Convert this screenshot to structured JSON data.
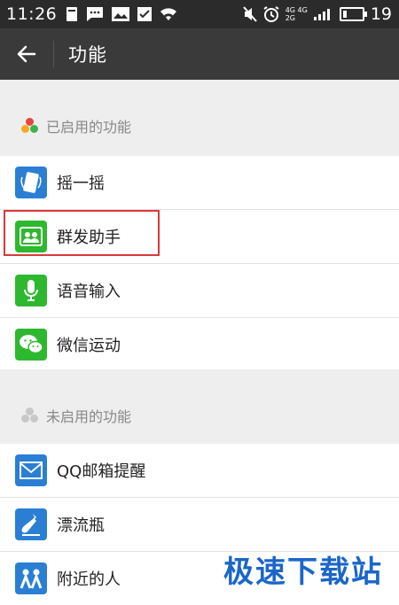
{
  "status_bar": {
    "time": "11:26",
    "network_top": "4G 4G",
    "network_bottom": "2G",
    "battery_level": "19",
    "battery_fraction": 0.19
  },
  "title_bar": {
    "title": "功能"
  },
  "enabled_section": {
    "header": "已启用的功能",
    "items": [
      {
        "label": "摇一摇",
        "icon": "shake-icon",
        "color": "#2a7fd4"
      },
      {
        "label": "群发助手",
        "icon": "mass-send-icon",
        "color": "#2eb82e"
      },
      {
        "label": "语音输入",
        "icon": "microphone-icon",
        "color": "#2eb82e"
      },
      {
        "label": "微信运动",
        "icon": "wechat-sports-icon",
        "color": "#2eb82e"
      }
    ]
  },
  "disabled_section": {
    "header": "未启用的功能",
    "items": [
      {
        "label": "QQ邮箱提醒",
        "icon": "mail-icon",
        "color": "#2a7fd4"
      },
      {
        "label": "漂流瓶",
        "icon": "bottle-icon",
        "color": "#2a7fd4"
      },
      {
        "label": "附近的人",
        "icon": "people-nearby-icon",
        "color": "#2a7fd4"
      }
    ]
  },
  "watermark": "极速下载站",
  "colors": {
    "enabled_dots": [
      "#e8453c",
      "#f5a623",
      "#3bb54a"
    ],
    "disabled_dots": "#c8c8c8",
    "highlight_border": "#d83a3a"
  }
}
